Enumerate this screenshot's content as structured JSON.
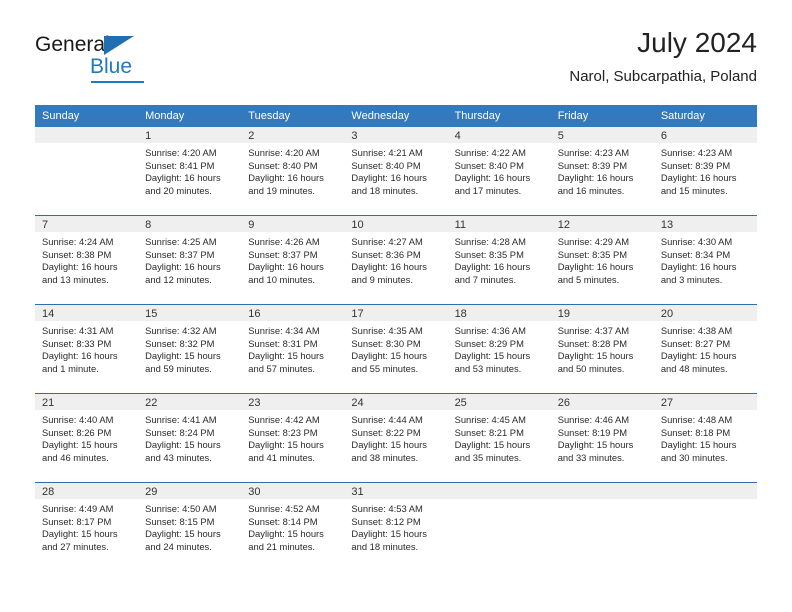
{
  "brand": {
    "name_top": "General",
    "name_bottom": "Blue",
    "accent_color": "#2079c4"
  },
  "header": {
    "month_title": "July 2024",
    "location": "Narol, Subcarpathia, Poland"
  },
  "theme": {
    "header_bg": "#3379bd",
    "day_number_bg": "#efefef",
    "week_divider": "#2f6fb0"
  },
  "calendar": {
    "weekday_headers": [
      "Sunday",
      "Monday",
      "Tuesday",
      "Wednesday",
      "Thursday",
      "Friday",
      "Saturday"
    ],
    "weeks": [
      [
        {
          "day": "",
          "sunrise": "",
          "sunset": "",
          "daylight": ""
        },
        {
          "day": "1",
          "sunrise": "Sunrise: 4:20 AM",
          "sunset": "Sunset: 8:41 PM",
          "daylight": "Daylight: 16 hours and 20 minutes."
        },
        {
          "day": "2",
          "sunrise": "Sunrise: 4:20 AM",
          "sunset": "Sunset: 8:40 PM",
          "daylight": "Daylight: 16 hours and 19 minutes."
        },
        {
          "day": "3",
          "sunrise": "Sunrise: 4:21 AM",
          "sunset": "Sunset: 8:40 PM",
          "daylight": "Daylight: 16 hours and 18 minutes."
        },
        {
          "day": "4",
          "sunrise": "Sunrise: 4:22 AM",
          "sunset": "Sunset: 8:40 PM",
          "daylight": "Daylight: 16 hours and 17 minutes."
        },
        {
          "day": "5",
          "sunrise": "Sunrise: 4:23 AM",
          "sunset": "Sunset: 8:39 PM",
          "daylight": "Daylight: 16 hours and 16 minutes."
        },
        {
          "day": "6",
          "sunrise": "Sunrise: 4:23 AM",
          "sunset": "Sunset: 8:39 PM",
          "daylight": "Daylight: 16 hours and 15 minutes."
        }
      ],
      [
        {
          "day": "7",
          "sunrise": "Sunrise: 4:24 AM",
          "sunset": "Sunset: 8:38 PM",
          "daylight": "Daylight: 16 hours and 13 minutes."
        },
        {
          "day": "8",
          "sunrise": "Sunrise: 4:25 AM",
          "sunset": "Sunset: 8:37 PM",
          "daylight": "Daylight: 16 hours and 12 minutes."
        },
        {
          "day": "9",
          "sunrise": "Sunrise: 4:26 AM",
          "sunset": "Sunset: 8:37 PM",
          "daylight": "Daylight: 16 hours and 10 minutes."
        },
        {
          "day": "10",
          "sunrise": "Sunrise: 4:27 AM",
          "sunset": "Sunset: 8:36 PM",
          "daylight": "Daylight: 16 hours and 9 minutes."
        },
        {
          "day": "11",
          "sunrise": "Sunrise: 4:28 AM",
          "sunset": "Sunset: 8:35 PM",
          "daylight": "Daylight: 16 hours and 7 minutes."
        },
        {
          "day": "12",
          "sunrise": "Sunrise: 4:29 AM",
          "sunset": "Sunset: 8:35 PM",
          "daylight": "Daylight: 16 hours and 5 minutes."
        },
        {
          "day": "13",
          "sunrise": "Sunrise: 4:30 AM",
          "sunset": "Sunset: 8:34 PM",
          "daylight": "Daylight: 16 hours and 3 minutes."
        }
      ],
      [
        {
          "day": "14",
          "sunrise": "Sunrise: 4:31 AM",
          "sunset": "Sunset: 8:33 PM",
          "daylight": "Daylight: 16 hours and 1 minute."
        },
        {
          "day": "15",
          "sunrise": "Sunrise: 4:32 AM",
          "sunset": "Sunset: 8:32 PM",
          "daylight": "Daylight: 15 hours and 59 minutes."
        },
        {
          "day": "16",
          "sunrise": "Sunrise: 4:34 AM",
          "sunset": "Sunset: 8:31 PM",
          "daylight": "Daylight: 15 hours and 57 minutes."
        },
        {
          "day": "17",
          "sunrise": "Sunrise: 4:35 AM",
          "sunset": "Sunset: 8:30 PM",
          "daylight": "Daylight: 15 hours and 55 minutes."
        },
        {
          "day": "18",
          "sunrise": "Sunrise: 4:36 AM",
          "sunset": "Sunset: 8:29 PM",
          "daylight": "Daylight: 15 hours and 53 minutes."
        },
        {
          "day": "19",
          "sunrise": "Sunrise: 4:37 AM",
          "sunset": "Sunset: 8:28 PM",
          "daylight": "Daylight: 15 hours and 50 minutes."
        },
        {
          "day": "20",
          "sunrise": "Sunrise: 4:38 AM",
          "sunset": "Sunset: 8:27 PM",
          "daylight": "Daylight: 15 hours and 48 minutes."
        }
      ],
      [
        {
          "day": "21",
          "sunrise": "Sunrise: 4:40 AM",
          "sunset": "Sunset: 8:26 PM",
          "daylight": "Daylight: 15 hours and 46 minutes."
        },
        {
          "day": "22",
          "sunrise": "Sunrise: 4:41 AM",
          "sunset": "Sunset: 8:24 PM",
          "daylight": "Daylight: 15 hours and 43 minutes."
        },
        {
          "day": "23",
          "sunrise": "Sunrise: 4:42 AM",
          "sunset": "Sunset: 8:23 PM",
          "daylight": "Daylight: 15 hours and 41 minutes."
        },
        {
          "day": "24",
          "sunrise": "Sunrise: 4:44 AM",
          "sunset": "Sunset: 8:22 PM",
          "daylight": "Daylight: 15 hours and 38 minutes."
        },
        {
          "day": "25",
          "sunrise": "Sunrise: 4:45 AM",
          "sunset": "Sunset: 8:21 PM",
          "daylight": "Daylight: 15 hours and 35 minutes."
        },
        {
          "day": "26",
          "sunrise": "Sunrise: 4:46 AM",
          "sunset": "Sunset: 8:19 PM",
          "daylight": "Daylight: 15 hours and 33 minutes."
        },
        {
          "day": "27",
          "sunrise": "Sunrise: 4:48 AM",
          "sunset": "Sunset: 8:18 PM",
          "daylight": "Daylight: 15 hours and 30 minutes."
        }
      ],
      [
        {
          "day": "28",
          "sunrise": "Sunrise: 4:49 AM",
          "sunset": "Sunset: 8:17 PM",
          "daylight": "Daylight: 15 hours and 27 minutes."
        },
        {
          "day": "29",
          "sunrise": "Sunrise: 4:50 AM",
          "sunset": "Sunset: 8:15 PM",
          "daylight": "Daylight: 15 hours and 24 minutes."
        },
        {
          "day": "30",
          "sunrise": "Sunrise: 4:52 AM",
          "sunset": "Sunset: 8:14 PM",
          "daylight": "Daylight: 15 hours and 21 minutes."
        },
        {
          "day": "31",
          "sunrise": "Sunrise: 4:53 AM",
          "sunset": "Sunset: 8:12 PM",
          "daylight": "Daylight: 15 hours and 18 minutes."
        },
        {
          "day": "",
          "sunrise": "",
          "sunset": "",
          "daylight": ""
        },
        {
          "day": "",
          "sunrise": "",
          "sunset": "",
          "daylight": ""
        },
        {
          "day": "",
          "sunrise": "",
          "sunset": "",
          "daylight": ""
        }
      ]
    ]
  }
}
